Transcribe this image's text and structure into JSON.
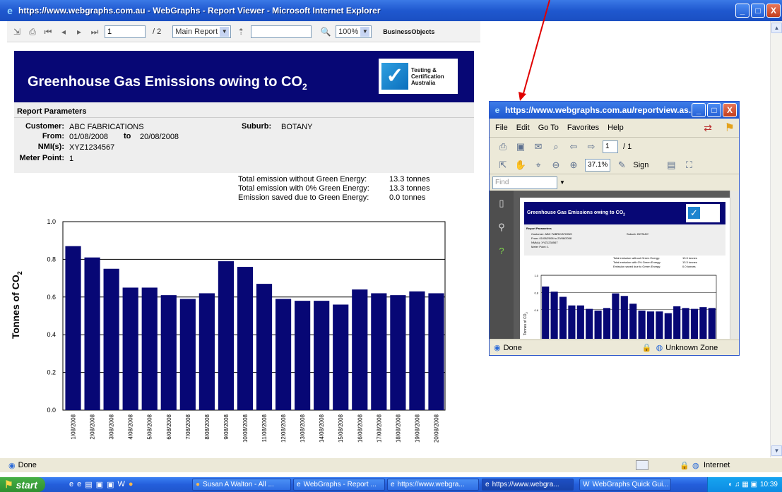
{
  "window": {
    "title": "https://www.webgraphs.com.au - WebGraphs - Report Viewer - Microsoft Internet Explorer",
    "min": "_",
    "max": "□",
    "close": "X"
  },
  "toolbar": {
    "page_input": "1",
    "page_total": "/ 2",
    "report_select": "Main Report",
    "search_value": "",
    "zoom": "100%",
    "brand_prefix": "Business",
    "brand_suffix": "Objects"
  },
  "report": {
    "title": "Greenhouse Gas Emissions owing to CO",
    "title_sub": "2",
    "logo_lines": [
      "Testing &",
      "Certification",
      "Australia"
    ],
    "params_title": "Report Parameters",
    "labels": {
      "customer": "Customer:",
      "from": "From:",
      "to": "to",
      "nmi": "NMI(s):",
      "meter": "Meter Point:",
      "suburb": "Suburb:"
    },
    "values": {
      "customer": "ABC FABRICATIONS",
      "from": "01/08/2008",
      "to": "20/08/2008",
      "nmi": "XYZ1234567",
      "meter": "1",
      "suburb": "BOTANY"
    },
    "emissions": [
      {
        "label": "Total emission without Green Energy:",
        "value": "13.3 tonnes"
      },
      {
        "label": "Total emission with 0% Green Energy:",
        "value": "13.3 tonnes"
      },
      {
        "label": "Emission saved due to Green Energy:",
        "value": "0.0 tonnes"
      }
    ]
  },
  "chart_data": {
    "type": "bar",
    "ylabel": "Tonnes of CO",
    "ylabel_sub": "2",
    "ylim": [
      0,
      1.0
    ],
    "yticks": [
      "0.0",
      "0.2",
      "0.4",
      "0.6",
      "0.8",
      "1.0"
    ],
    "categories": [
      "1/08/2008",
      "2/08/2008",
      "3/08/2008",
      "4/08/2008",
      "5/08/2008",
      "6/08/2008",
      "7/08/2008",
      "8/08/2008",
      "9/08/2008",
      "10/08/2008",
      "11/08/2008",
      "12/08/2008",
      "13/08/2008",
      "14/08/2008",
      "15/08/2008",
      "16/08/2008",
      "17/08/2008",
      "18/08/2008",
      "19/08/2008",
      "20/08/2008"
    ],
    "values": [
      0.87,
      0.81,
      0.75,
      0.65,
      0.65,
      0.61,
      0.59,
      0.62,
      0.79,
      0.76,
      0.67,
      0.59,
      0.58,
      0.58,
      0.56,
      0.64,
      0.62,
      0.61,
      0.63,
      0.62
    ],
    "bar_color": "#070775",
    "grid": true
  },
  "popup": {
    "title": "https://www.webgraphs.com.au/reportview.as...",
    "menu": [
      "File",
      "Edit",
      "Go To",
      "Favorites",
      "Help"
    ],
    "page_input": "1",
    "page_total": "/ 1",
    "zoom": "37.1%",
    "sign": "Sign",
    "find_placeholder": "Find",
    "status_left": "Done",
    "status_zone": "Unknown Zone",
    "mini": {
      "title": "Greenhouse Gas Emissions owing to CO",
      "title_sub": "2",
      "params_title": "Report Parameters",
      "rows": [
        "Customer:  ABC FABRICATIONS",
        "From:  01/08/2008  to  20/08/2008",
        "NMI(s):  XYZ1234567",
        "Meter Point:  1"
      ],
      "suburb": "Suburb:  BOTANY",
      "emissions": [
        "Total emission without Green Energy:",
        "Total emission with 0% Green Energy:",
        "Emission saved due to Green Energy:"
      ],
      "emission_values": [
        "13.3 tonnes",
        "13.3 tonnes",
        "0.0 tonnes"
      ],
      "ylabel": "Tonnes of CO",
      "ylabel_sub": "2",
      "yticks": [
        "1.0",
        "0.8",
        "0.6"
      ]
    }
  },
  "status": {
    "left": "Done",
    "zone": "Internet"
  },
  "taskbar": {
    "start": "start",
    "items": [
      "Susan A Walton - All ...",
      "WebGraphs - Report ...",
      "https://www.webgra...",
      "https://www.webgra...",
      "WebGraphs Quick Gui..."
    ],
    "clock": "10:39"
  }
}
